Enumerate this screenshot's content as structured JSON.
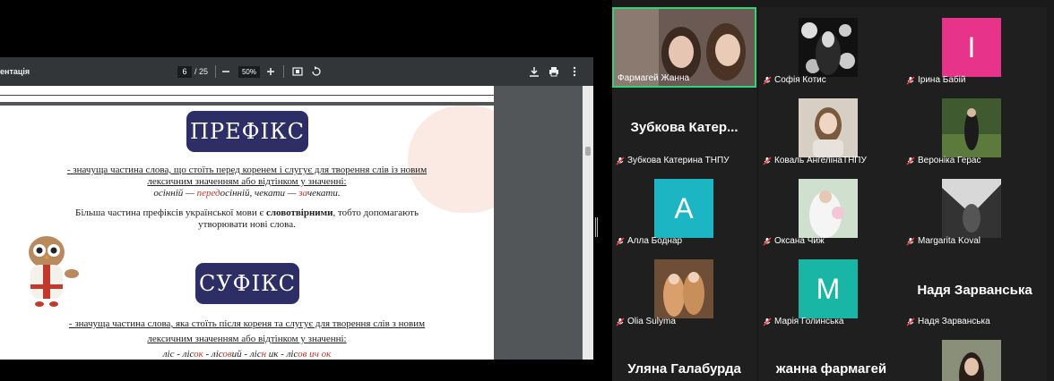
{
  "viewer": {
    "doc_title": "ентація",
    "page_current": "6",
    "page_sep": "/ 25",
    "zoom": "50%",
    "icons": [
      "minus-icon",
      "plus-icon",
      "fit-page-icon",
      "rotate-icon",
      "download-icon",
      "print-icon",
      "more-icon"
    ]
  },
  "slide": {
    "prefix_title": "ПРЕФІКС",
    "prefix_def_1": "- значуща частина слова, що стоїть перед коренем і слугує для творення слів із новим",
    "prefix_def_2": "лексичним значенням або відтінком у значенні:",
    "prefix_ex_a": "осінній",
    "prefix_ex_dash1": " — ",
    "prefix_ex_b_hl": "перед",
    "prefix_ex_b": "осінній, чекати",
    "prefix_ex_dash2": " — ",
    "prefix_ex_c_hl": "за",
    "prefix_ex_c": "чекати.",
    "prefix_note_1a": "Більша частина префіксів української мови є ",
    "prefix_note_1b": "словотвірними",
    "prefix_note_1c": ", тобто допомагають",
    "prefix_note_2": "утворювати нові слова.",
    "suffix_title": "СУФІКС",
    "suffix_def_1": "- значуща частина слова, яка стоїть після кореня та слугує для творення слів з новим",
    "suffix_def_2": "лексичним значенням або відтінком у значенні:",
    "suffix_ex": "ліс - ліс",
    "suffix_ex_hl1": "ок",
    "suffix_ex_b": " - ліс",
    "suffix_ex_hl2": "ов",
    "suffix_ex_c": "ий - ліс",
    "suffix_ex_hl3": "н",
    "suffix_ex_d": " ик - ліс",
    "suffix_ex_hl4": "ов ич ок"
  },
  "participants": [
    {
      "name": "Фармагей Жанна",
      "type": "video",
      "active": true
    },
    {
      "name": "Софія Котис",
      "type": "photo",
      "muted": true
    },
    {
      "name": "Ірина Бабій",
      "type": "letter",
      "letter": "I",
      "color": "#e8338a",
      "muted": true
    },
    {
      "name": "Зубкова Катерина ТНПУ",
      "type": "text",
      "display": "Зубкова  Катер...",
      "muted": true
    },
    {
      "name": "Коваль АнгелінаТНПУ",
      "type": "photo",
      "muted": true
    },
    {
      "name": "Вероніка Герас",
      "type": "photo",
      "muted": true
    },
    {
      "name": "Алла Боднар",
      "type": "letter",
      "letter": "A",
      "color": "#1cb5c4",
      "muted": true
    },
    {
      "name": "Оксана Чиж",
      "type": "photo",
      "muted": true
    },
    {
      "name": "Margarita Koval",
      "type": "photo",
      "muted": true
    },
    {
      "name": "Olia Sulyma",
      "type": "photo",
      "muted": true
    },
    {
      "name": "Марія Голинська",
      "type": "letter",
      "letter": "M",
      "color": "#19b5a5",
      "muted": true
    },
    {
      "name": "Надя Зарванська",
      "type": "text",
      "display": "Надя Зарванська",
      "muted": true
    },
    {
      "name": "",
      "type": "text",
      "display": "Уляна Галабурда"
    },
    {
      "name": "",
      "type": "text",
      "display": "жанна фармагей"
    },
    {
      "name": "",
      "type": "photo"
    }
  ]
}
